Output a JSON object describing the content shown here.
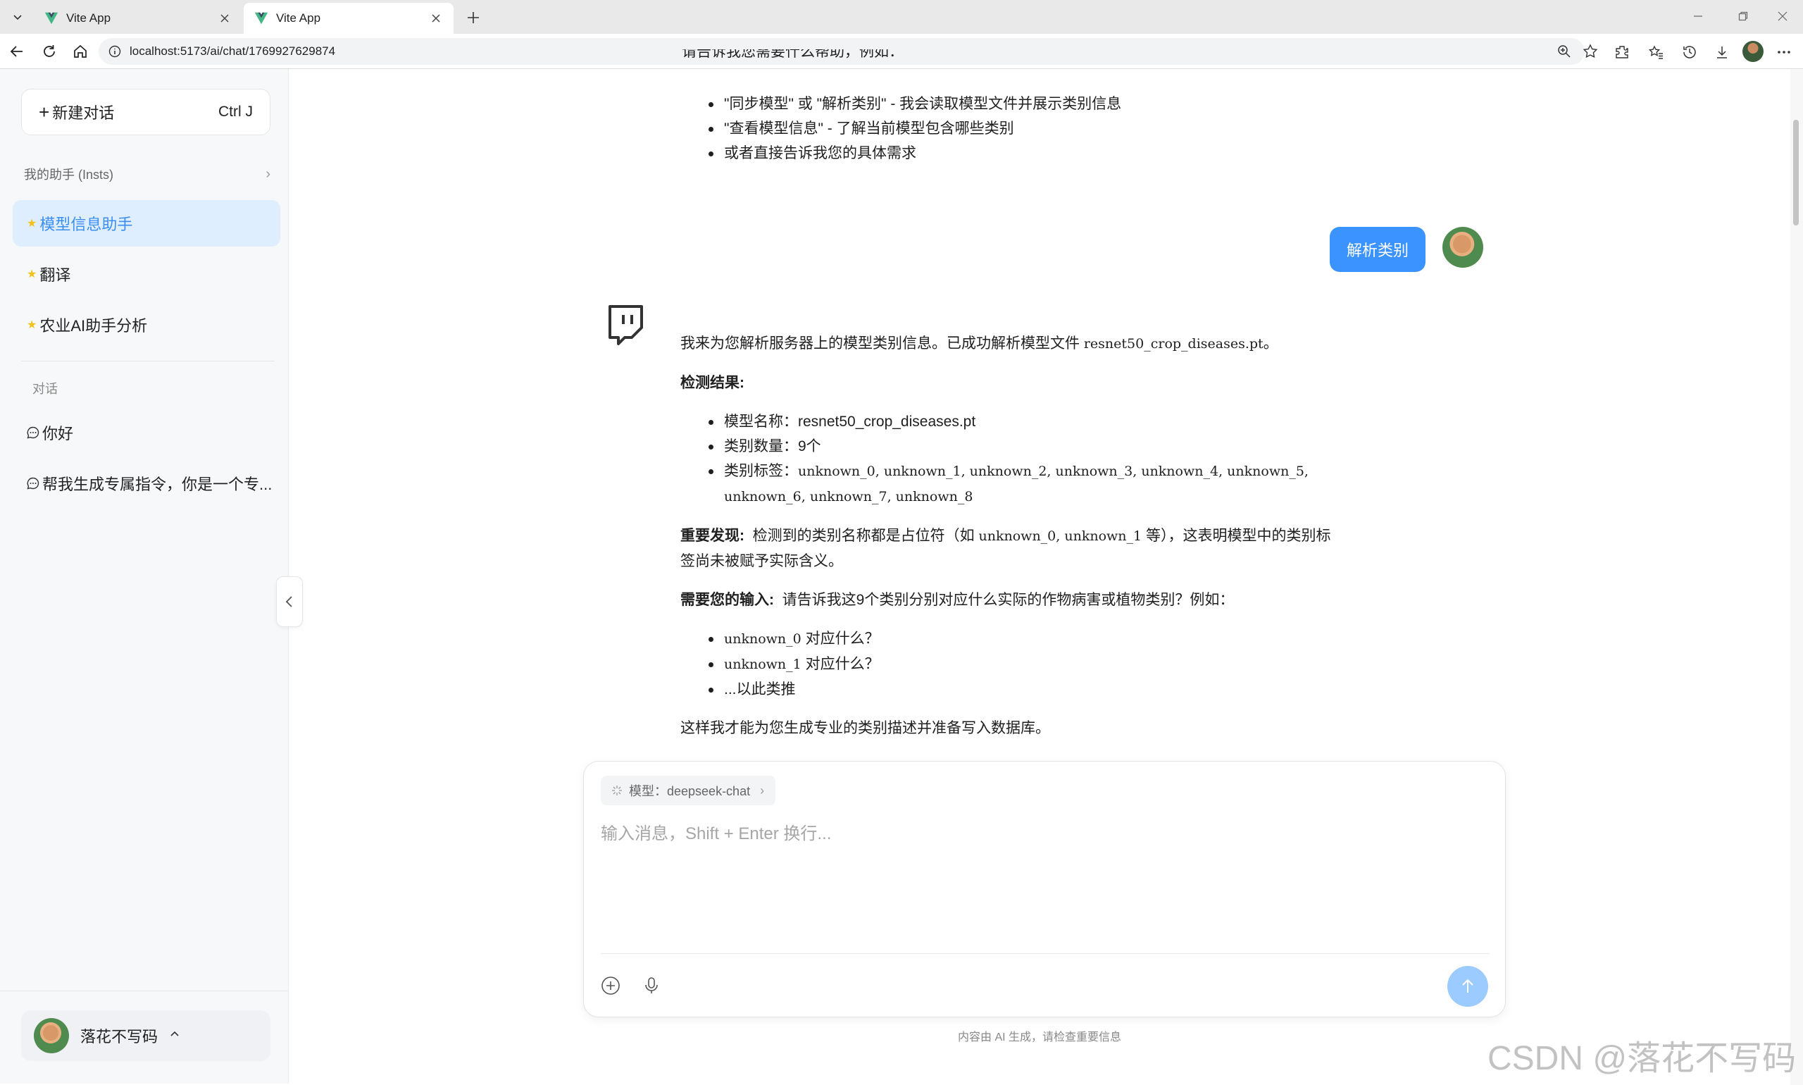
{
  "browser": {
    "tabs": [
      {
        "title": "Vite App",
        "active": false
      },
      {
        "title": "Vite App",
        "active": true
      }
    ],
    "url": "localhost:5173/ai/chat/1769927629874"
  },
  "sidebar": {
    "new_chat_label": "新建对话",
    "new_chat_shortcut": "Ctrl J",
    "assistants_header": "我的助手 (Insts)",
    "assistants": [
      {
        "label": "模型信息助手",
        "active": true
      },
      {
        "label": "翻译",
        "active": false
      },
      {
        "label": "农业AI助手分析",
        "active": false
      }
    ],
    "conversations_header": "对话",
    "conversations": [
      {
        "label": "你好"
      },
      {
        "label": "帮我生成专属指令，你是一个专..."
      }
    ],
    "user_name": "落花不写码"
  },
  "chat": {
    "top_partial_line": "请告诉我您需要什么帮助，例如：",
    "top_bullets": [
      "\"同步模型\" 或 \"解析类别\" - 我会读取模型文件并展示类别信息",
      "\"查看模型信息\" - 了解当前模型包含哪些类别",
      "或者直接告诉我您的具体需求"
    ],
    "user_message": "解析类别",
    "reply": {
      "intro": "我来为您解析服务器上的模型类别信息。已成功解析模型文件",
      "intro_file": "resnet50_crop_diseases.pt",
      "intro_end": "。",
      "result_heading": "检测结果:",
      "result_items": [
        {
          "label": "模型名称：",
          "value": "resnet50_crop_diseases.pt"
        },
        {
          "label": "类别数量：",
          "value": "9个"
        },
        {
          "label": "类别标签：",
          "value": "unknown_0, unknown_1, unknown_2, unknown_3, unknown_4, unknown_5, unknown_6, unknown_7, unknown_8"
        }
      ],
      "finding_heading": "重要发现:",
      "finding_text_1": "检测到的类别名称都是占位符（如",
      "finding_code": "unknown_0, unknown_1",
      "finding_text_2": "等），这表明模型中的类别标签尚未被赋予实际含义。",
      "need_heading": "需要您的输入:",
      "need_text": "请告诉我这9个类别分别对应什么实际的作物病害或植物类别？例如：",
      "need_items": [
        {
          "code": "unknown_0",
          "text": "对应什么？"
        },
        {
          "code": "unknown_1",
          "text": "对应什么？"
        },
        {
          "code": "",
          "text": "...以此类推"
        }
      ],
      "closing": "这样我才能为您生成专业的类别描述并准备写入数据库。"
    }
  },
  "input": {
    "model_label": "模型：deepseek-chat",
    "placeholder": "输入消息，Shift + Enter 换行...",
    "disclaimer": "内容由 AI 生成，请检查重要信息"
  },
  "watermark": "CSDN @落花不写码",
  "colors": {
    "accent": "#3b93ff",
    "active_bg": "#dfeeff",
    "send_disabled": "#9ccbff",
    "star": "#f2c21b"
  }
}
